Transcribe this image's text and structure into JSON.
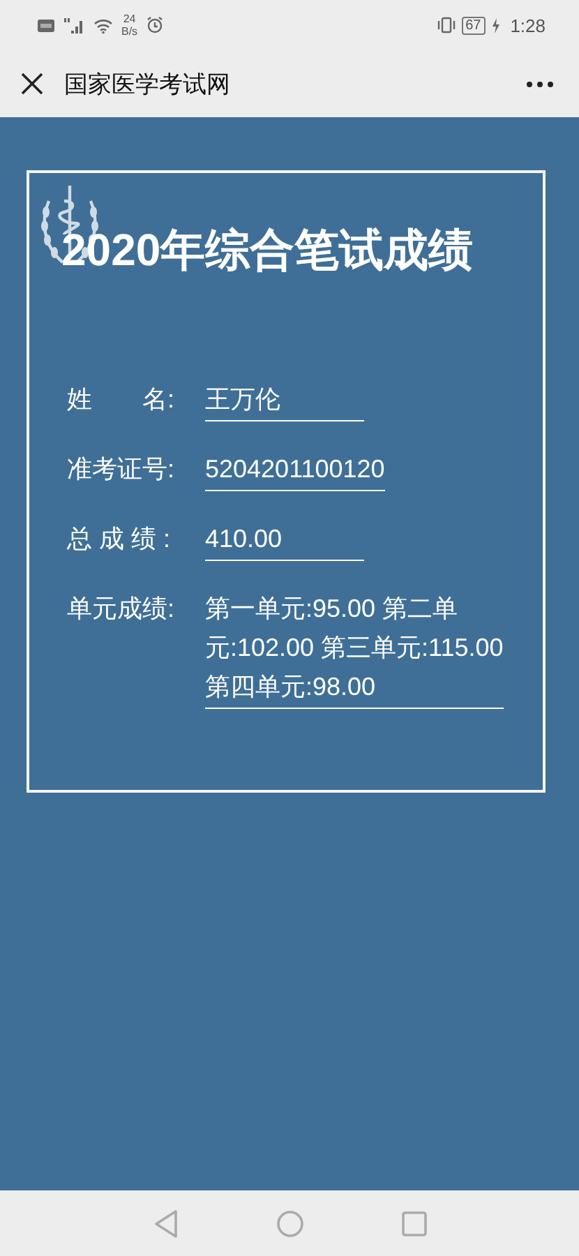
{
  "status_bar": {
    "speed": "24",
    "speed_unit": "B/s",
    "battery": "67",
    "time": "1:28"
  },
  "header": {
    "title": "国家医学考试网"
  },
  "card": {
    "title": "2020年综合笔试成绩",
    "fields": [
      {
        "label": "姓　　名:",
        "value": "王万伦",
        "kind": "short"
      },
      {
        "label": "准考证号:",
        "value": "5204201100120",
        "kind": "fit"
      },
      {
        "label": "总 成 绩 :",
        "value": "410.00",
        "kind": "short"
      },
      {
        "label": "单元成绩:",
        "value": "第一单元:95.00 第二单元:102.00 第三单元:115.00 第四单元:98.00",
        "kind": "wide"
      }
    ]
  }
}
